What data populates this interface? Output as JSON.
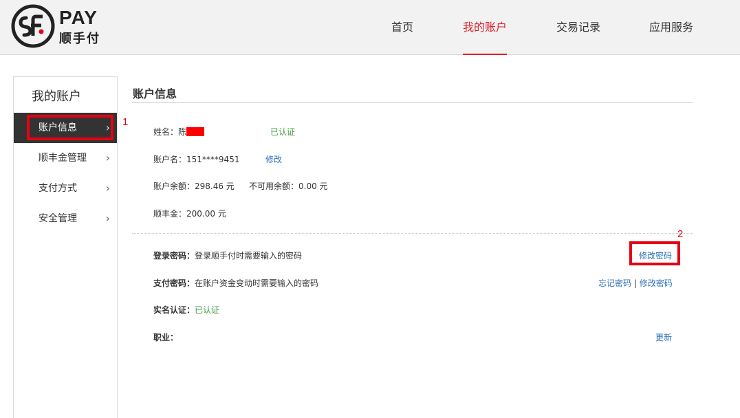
{
  "brand": {
    "pay": "PAY",
    "name": "顺手付"
  },
  "nav": [
    {
      "label": "首页"
    },
    {
      "label": "我的账户",
      "active": true
    },
    {
      "label": "交易记录"
    },
    {
      "label": "应用服务"
    }
  ],
  "sidebar": {
    "title": "我的账户",
    "items": [
      {
        "label": "账户信息",
        "active": true
      },
      {
        "label": "顺丰金管理"
      },
      {
        "label": "支付方式"
      },
      {
        "label": "安全管理"
      }
    ]
  },
  "annotations": {
    "one": "1",
    "two": "2"
  },
  "account": {
    "title": "账户信息",
    "name_label": "姓名：",
    "name_value": "陈",
    "name_status": "已认证",
    "account_label": "账户名：",
    "account_value": "151****9451",
    "account_edit": "修改",
    "balance_label": "账户余额：",
    "balance_value": "298.46 元",
    "unavailable_label": "不可用余额：",
    "unavailable_value": "0.00 元",
    "sfgold_label": "顺丰金：",
    "sfgold_value": "200.00 元"
  },
  "security": {
    "login_label": "登录密码：",
    "login_desc": "登录顺手付时需要输入的密码",
    "login_action": "修改密码",
    "pay_label": "支付密码：",
    "pay_desc": "在账户资金变动时需要输入的密码",
    "pay_forgot": "忘记密码",
    "pay_sep": "|",
    "pay_action": "修改密码",
    "realname_label": "实名认证：",
    "realname_value": "已认证",
    "job_label": "职业：",
    "job_action": "更新"
  },
  "colors": {
    "accent": "#d9232e",
    "annotation": "#e60012",
    "link": "#2e6fb5",
    "ok": "#3c9a3c",
    "sidebar_active": "#333333"
  }
}
